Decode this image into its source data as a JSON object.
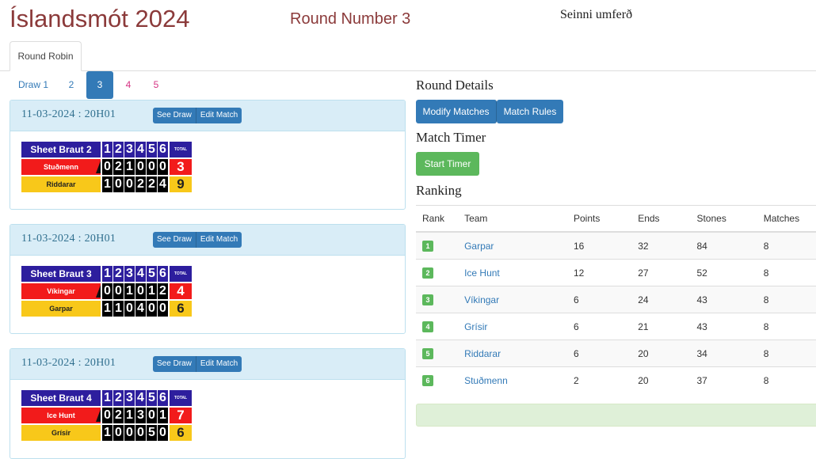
{
  "header": {
    "title": "Íslandsmót 2024",
    "round_number": "Round Number 3",
    "round_half": "Seinni umferð"
  },
  "tabs": [
    {
      "label": "Round Robin"
    }
  ],
  "draws": [
    {
      "label": "Draw 1"
    },
    {
      "label": "2"
    },
    {
      "label": "3"
    },
    {
      "label": "4"
    },
    {
      "label": "5"
    }
  ],
  "active_draw": "3",
  "matches": [
    {
      "date": "11-03-2024 : 20H01",
      "see_draw": "See Draw",
      "edit_match": "Edit Match",
      "sheet": "Sheet Braut 2",
      "ends_header": [
        "1",
        "2",
        "3",
        "4",
        "5",
        "6"
      ],
      "total_label": "TOTAL",
      "teams": [
        {
          "name": "Stuðmenn",
          "color": "red",
          "ends": [
            "0",
            "2",
            "1",
            "0",
            "0",
            "0"
          ],
          "total": "3",
          "hammer": true
        },
        {
          "name": "Riddarar",
          "color": "yellow",
          "ends": [
            "1",
            "0",
            "0",
            "2",
            "2",
            "4"
          ],
          "total": "9",
          "hammer": false
        }
      ]
    },
    {
      "date": "11-03-2024 : 20H01",
      "see_draw": "See Draw",
      "edit_match": "Edit Match",
      "sheet": "Sheet Braut 3",
      "ends_header": [
        "1",
        "2",
        "3",
        "4",
        "5",
        "6"
      ],
      "total_label": "TOTAL",
      "teams": [
        {
          "name": "Víkingar",
          "color": "red",
          "ends": [
            "0",
            "0",
            "1",
            "0",
            "1",
            "2"
          ],
          "total": "4",
          "hammer": true
        },
        {
          "name": "Garpar",
          "color": "yellow",
          "ends": [
            "1",
            "1",
            "0",
            "4",
            "0",
            "0"
          ],
          "total": "6",
          "hammer": false
        }
      ]
    },
    {
      "date": "11-03-2024 : 20H01",
      "see_draw": "See Draw",
      "edit_match": "Edit Match",
      "sheet": "Sheet Braut 4",
      "ends_header": [
        "1",
        "2",
        "3",
        "4",
        "5",
        "6"
      ],
      "total_label": "TOTAL",
      "teams": [
        {
          "name": "Ice Hunt",
          "color": "red",
          "ends": [
            "0",
            "2",
            "1",
            "3",
            "0",
            "1"
          ],
          "total": "7",
          "hammer": true
        },
        {
          "name": "Grísir",
          "color": "yellow",
          "ends": [
            "1",
            "0",
            "0",
            "0",
            "5",
            "0"
          ],
          "total": "6",
          "hammer": false
        }
      ]
    }
  ],
  "round_details": {
    "heading": "Round Details",
    "modify_matches": "Modify Matches",
    "match_rules": "Match Rules"
  },
  "match_timer": {
    "heading": "Match Timer",
    "start_timer": "Start Timer"
  },
  "ranking": {
    "heading": "Ranking",
    "columns": [
      "Rank",
      "Team",
      "Points",
      "Ends",
      "Stones",
      "Matches"
    ],
    "rows": [
      {
        "rank": "1",
        "team": "Garpar",
        "points": "16",
        "ends": "32",
        "stones": "84",
        "matches": "8"
      },
      {
        "rank": "2",
        "team": "Ice Hunt",
        "points": "12",
        "ends": "27",
        "stones": "52",
        "matches": "8"
      },
      {
        "rank": "3",
        "team": "Víkingar",
        "points": "6",
        "ends": "24",
        "stones": "43",
        "matches": "8"
      },
      {
        "rank": "4",
        "team": "Grísir",
        "points": "6",
        "ends": "21",
        "stones": "43",
        "matches": "8"
      },
      {
        "rank": "5",
        "team": "Riddarar",
        "points": "6",
        "ends": "20",
        "stones": "34",
        "matches": "8"
      },
      {
        "rank": "6",
        "team": "Stuðmenn",
        "points": "2",
        "ends": "20",
        "stones": "37",
        "matches": "8"
      }
    ]
  },
  "colors": {
    "title_color": "#8b3a3a",
    "primary": "#337ab7",
    "success": "#5cb85c",
    "card_header": "#d9edf7",
    "scoreboard_blue": "#2d1e9e",
    "team_red": "#f21b1b",
    "team_yellow": "#f8c81a"
  }
}
